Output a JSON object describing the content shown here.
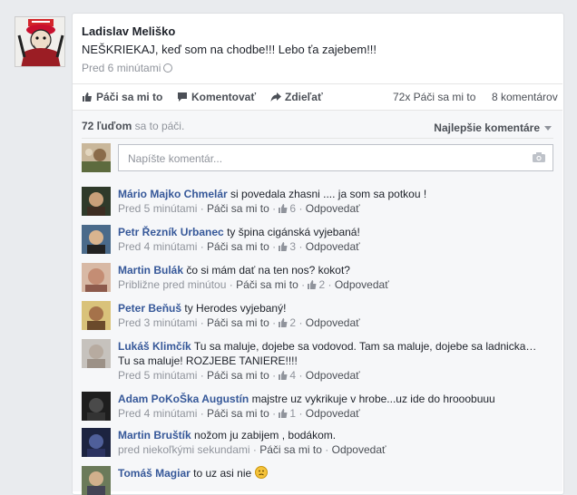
{
  "post": {
    "author": "Ladislav Meliško",
    "text": "NEŠKRIEKAJ, keď som na chodbe!!! Lebo ťa zajebem!!!",
    "time": "Pred 6 minútami"
  },
  "actions": {
    "like": "Páči sa mi to",
    "comment": "Komentovať",
    "share": "Zdieľať",
    "likes_count": "72x Páči sa mi to",
    "comments_count": "8 komentárov"
  },
  "summary": {
    "likes_bold": "72 ľuďom",
    "likes_rest": " sa to páči.",
    "sort_label": "Najlepšie komentáre"
  },
  "composer": {
    "placeholder": "Napíšte komentár..."
  },
  "comments": [
    {
      "name": "Mário Majko Chmelár",
      "text": "si povedala zhasni .... ja som sa potkou !",
      "time": "Pred 5 minútami",
      "like": "Páči sa mi to",
      "likes": "6",
      "reply": "Odpovedať"
    },
    {
      "name": "Petr Řezník Urbanec",
      "text": "ty špina cigánská vyjebaná!",
      "time": "Pred 4 minútami",
      "like": "Páči sa mi to",
      "likes": "3",
      "reply": "Odpovedať"
    },
    {
      "name": "Martin Bulák",
      "text": "čo si mám dať na ten nos? kokot?",
      "time": "Približne pred minútou",
      "like": "Páči sa mi to",
      "likes": "2",
      "reply": "Odpovedať"
    },
    {
      "name": "Peter Beňuš",
      "text": "ty Herodes vyjebaný!",
      "time": "Pred 3 minútami",
      "like": "Páči sa mi to",
      "likes": "2",
      "reply": "Odpovedať"
    },
    {
      "name": "Lukáš Klimčík",
      "text": "Tu sa maluje, dojebe sa vodovod. Tam sa maluje, dojebe sa ladnicka… Tu sa maluje! ROZJEBE TANIERE!!!!",
      "time": "Pred 5 minútami",
      "like": "Páči sa mi to",
      "likes": "4",
      "reply": "Odpovedať"
    },
    {
      "name": "Adam PoKoŠka Augustín",
      "text": "majstre uz vykrikuje v hrobe...uz ide do hrooobuuu",
      "time": "Pred 4 minútami",
      "like": "Páči sa mi to",
      "likes": "1",
      "reply": "Odpovedať"
    },
    {
      "name": "Martin Bruštík",
      "text": "nožom ju zabijem , bodákom.",
      "time": "pred niekoľkými sekundami",
      "like": "Páči sa mi to",
      "likes": "",
      "reply": "Odpovedať"
    },
    {
      "name": "Tomáš Magiar",
      "text": "to uz asi nie",
      "time": "",
      "like": "",
      "likes": "",
      "reply": ""
    }
  ],
  "colors": {
    "link": "#365899",
    "muted": "#90949c",
    "action": "#4b4f56",
    "background": "#e9ebee"
  }
}
